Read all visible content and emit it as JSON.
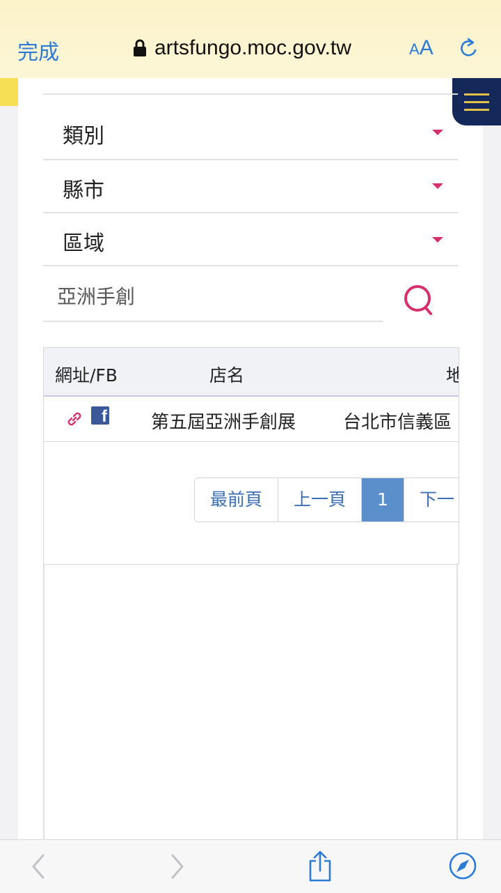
{
  "browser": {
    "done_label": "完成",
    "url": "artsfungo.moc.gov.tw",
    "text_size_small": "A",
    "text_size_large": "A",
    "accent_color": "#2b7ad8"
  },
  "filters": {
    "category_label": "類別",
    "city_label": "縣市",
    "area_label": "區域",
    "search_value": "亞洲手創"
  },
  "table": {
    "headers": [
      "網址/FB",
      "店名",
      "地"
    ],
    "rows": [
      {
        "name": "第五屆亞洲手創展",
        "address": "台北市信義區"
      }
    ]
  },
  "pagination": {
    "first": "最前頁",
    "prev": "上一頁",
    "current": "1",
    "next": "下一"
  },
  "icons": {
    "link": "link-icon",
    "facebook": "facebook-icon",
    "search": "search-icon",
    "menu": "hamburger-menu-icon",
    "back": "back-arrow-icon",
    "forward": "forward-arrow-icon",
    "share": "share-icon",
    "compass": "compass-icon"
  }
}
